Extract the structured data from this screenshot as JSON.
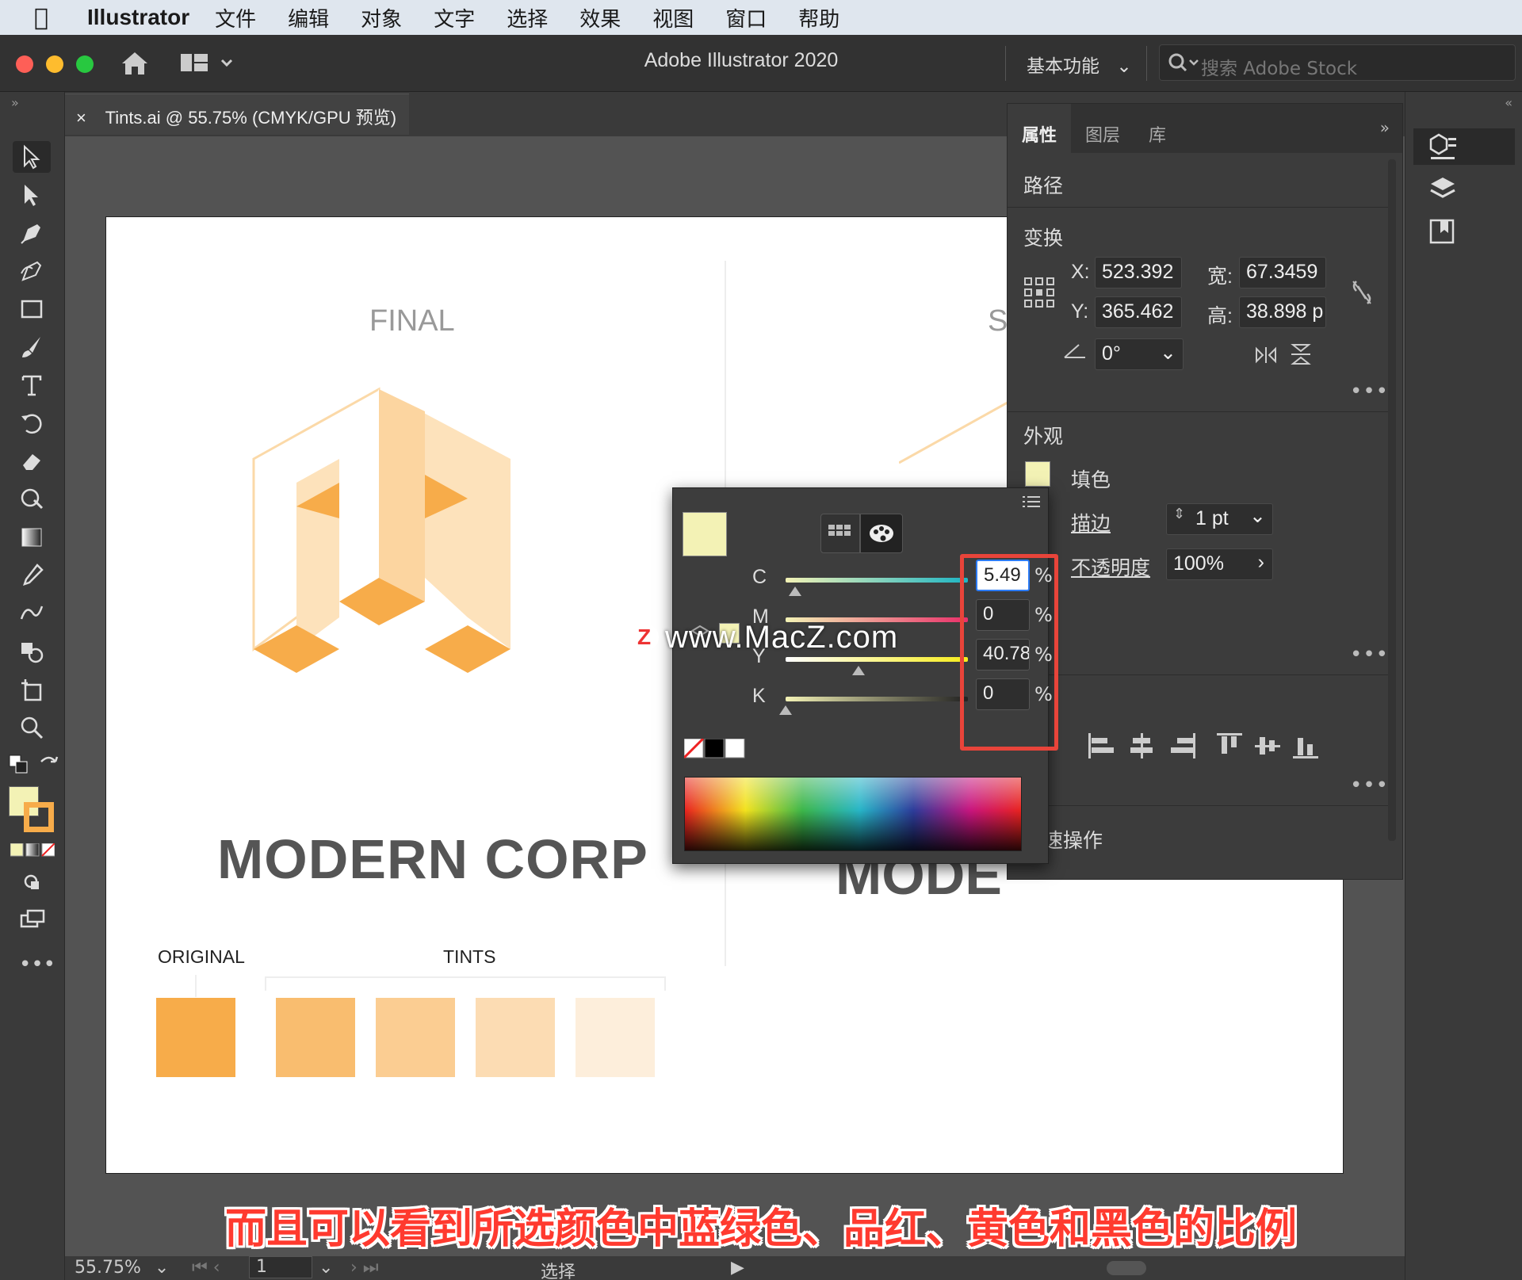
{
  "menubar": {
    "app": "Illustrator",
    "items": [
      "文件",
      "编辑",
      "对象",
      "文字",
      "选择",
      "效果",
      "视图",
      "窗口",
      "帮助"
    ]
  },
  "appbar": {
    "title": "Adobe Illustrator 2020",
    "workspace": "基本功能",
    "search_placeholder": "搜索 Adobe Stock"
  },
  "document_tab": {
    "close": "×",
    "title": "Tints.ai @ 55.75% (CMYK/GPU 预览)"
  },
  "artboard": {
    "left_label": "FINAL",
    "right_label_partial": "ST",
    "corp_name": "MODERN CORP",
    "corp_name_partial": "MODE",
    "original_label": "ORIGINAL",
    "tints_label": "TINTS",
    "swatches": [
      "#f7ac4a",
      "#f9bd6f",
      "#fbcd92",
      "#fcdcb3",
      "#fdeedb"
    ]
  },
  "properties": {
    "tabs": [
      "属性",
      "图层",
      "库"
    ],
    "object_type": "路径",
    "transform_title": "变换",
    "x_label": "X:",
    "x": "523.392",
    "y_label": "Y:",
    "y": "365.462",
    "w_label": "宽:",
    "w": "67.3459",
    "h_label": "高:",
    "h": "38.898 p",
    "angle": "0°",
    "appearance_title": "外观",
    "fill_label": "填色",
    "stroke_label": "描边",
    "stroke_value": "1 pt",
    "opacity_label": "不透明度",
    "opacity_value": "100%",
    "quick_actions": "快速操作",
    "fill_color": "#f3f2b5"
  },
  "color_picker": {
    "c_label": "C",
    "c": "5.49",
    "m_label": "M",
    "m": "0",
    "y_label": "Y",
    "y": "40.78",
    "k_label": "K",
    "k": "0",
    "pct": "%",
    "current_color": "#f3f2b5"
  },
  "watermark": {
    "logo": "Z",
    "text": "www.MacZ.com"
  },
  "caption": "而且可以看到所选颜色中蓝绿色、品红、黄色和黑色的比例",
  "status": {
    "zoom": "55.75%",
    "page": "1",
    "tool": "选择"
  }
}
